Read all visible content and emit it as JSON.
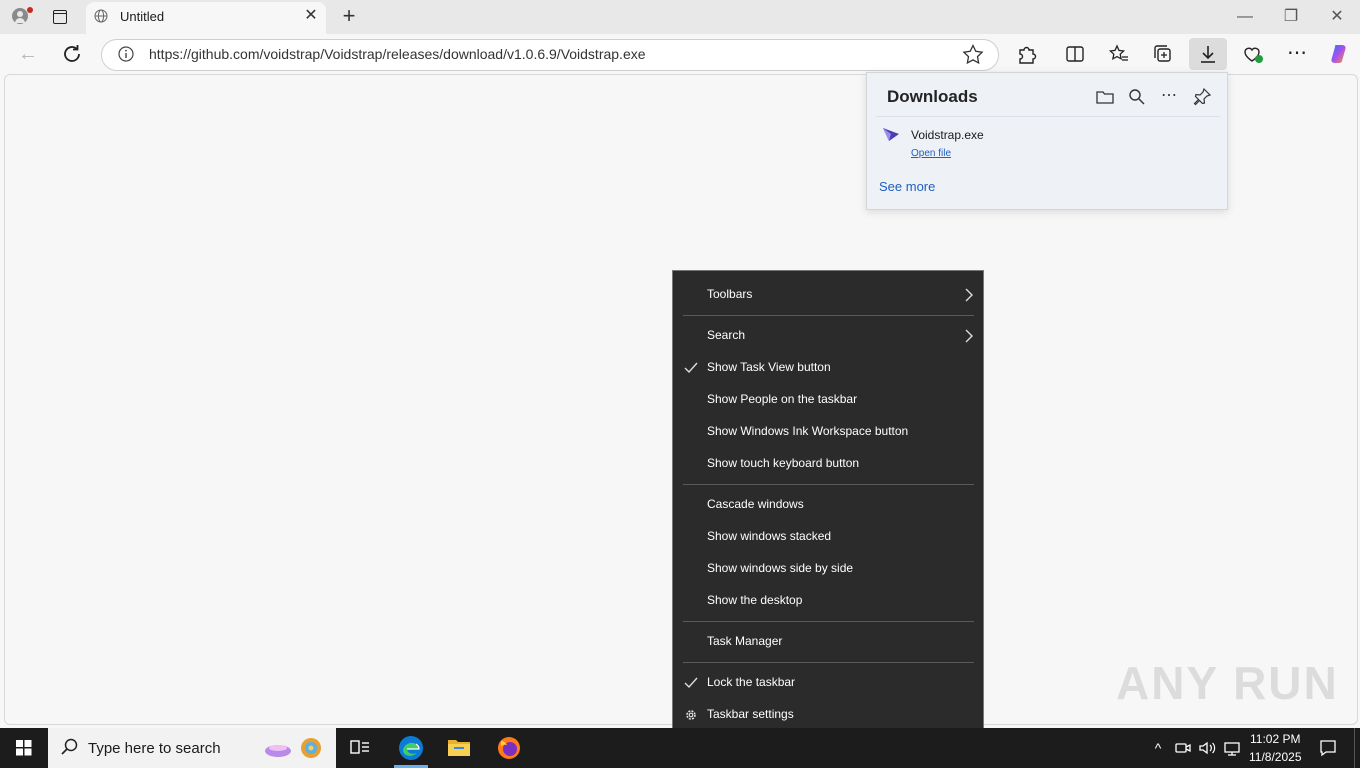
{
  "browser": {
    "tab_title": "Untitled",
    "url": "https://github.com/voidstrap/Voidstrap/releases/download/v1.0.6.9/Voidstrap.exe"
  },
  "downloads": {
    "title": "Downloads",
    "file_name": "Voidstrap.exe",
    "open_file": "Open file",
    "see_more": "See more"
  },
  "context_menu": {
    "items": [
      {
        "label": "Toolbars",
        "checked": false,
        "submenu": true
      },
      {
        "label": "Search",
        "checked": false,
        "submenu": true
      },
      {
        "label": "Show Task View button",
        "checked": true
      },
      {
        "label": "Show People on the taskbar",
        "checked": false
      },
      {
        "label": "Show Windows Ink Workspace button",
        "checked": false
      },
      {
        "label": "Show touch keyboard button",
        "checked": false
      },
      {
        "label": "Cascade windows",
        "checked": false
      },
      {
        "label": "Show windows stacked",
        "checked": false
      },
      {
        "label": "Show windows side by side",
        "checked": false
      },
      {
        "label": "Show the desktop",
        "checked": false
      },
      {
        "label": "Task Manager",
        "checked": false
      },
      {
        "label": "Lock the taskbar",
        "checked": true
      },
      {
        "label": "Taskbar settings",
        "icon": "gear-icon"
      }
    ]
  },
  "watermark": "ANY RUN",
  "taskbar": {
    "search_placeholder": "Type here to search",
    "time": "11:02 PM",
    "date": "11/8/2025"
  },
  "colors": {
    "menu_bg": "#2b2b2b",
    "taskbar_bg": "#1c1c1c",
    "link": "#1f5fbf",
    "edge_blue": "#0c7bd6"
  }
}
